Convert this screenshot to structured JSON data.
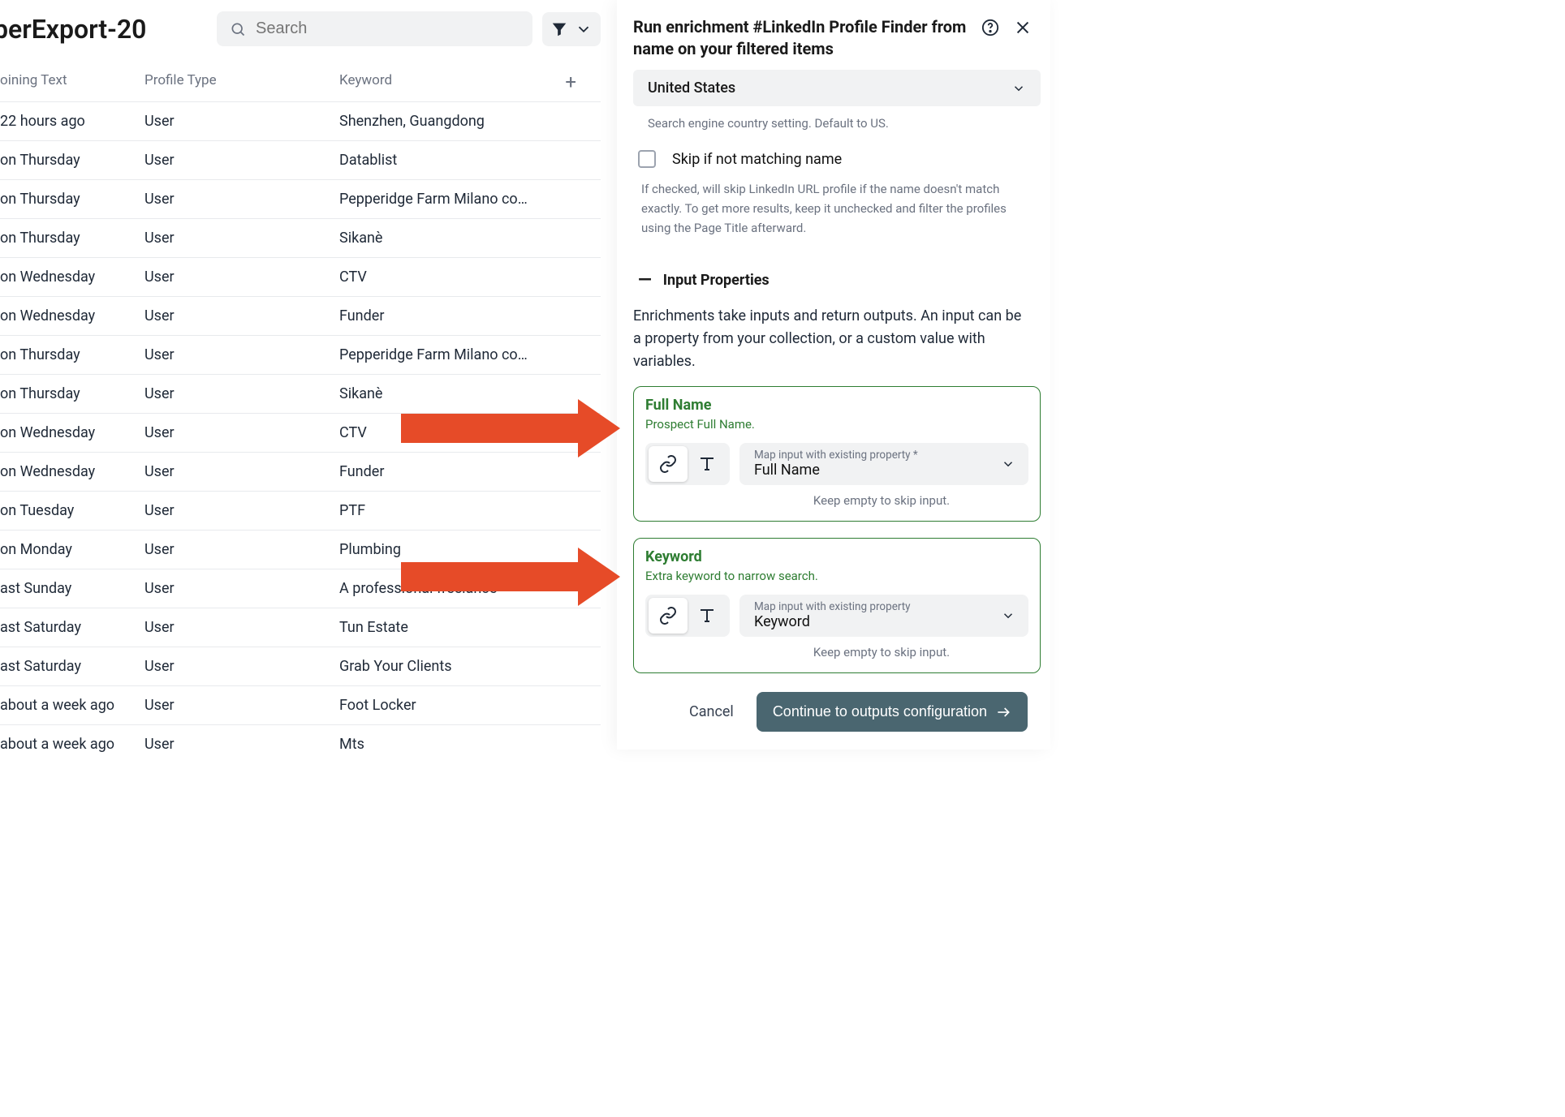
{
  "page": {
    "title": "berExport-20"
  },
  "search": {
    "placeholder": "Search"
  },
  "table": {
    "headers": {
      "joining": "oining Text",
      "profile": "Profile Type",
      "keyword": "Keyword"
    },
    "rows": [
      {
        "joining": "22 hours ago",
        "profile": "User",
        "keyword": "Shenzhen, Guangdong"
      },
      {
        "joining": "on Thursday",
        "profile": "User",
        "keyword": "Datablist"
      },
      {
        "joining": "on Thursday",
        "profile": "User",
        "keyword": "Pepperidge Farm Milano co…"
      },
      {
        "joining": "on Thursday",
        "profile": "User",
        "keyword": "Sikanè"
      },
      {
        "joining": "on Wednesday",
        "profile": "User",
        "keyword": "CTV"
      },
      {
        "joining": "on Wednesday",
        "profile": "User",
        "keyword": "Funder"
      },
      {
        "joining": "on Thursday",
        "profile": "User",
        "keyword": "Pepperidge Farm Milano co…"
      },
      {
        "joining": "on Thursday",
        "profile": "User",
        "keyword": "Sikanè"
      },
      {
        "joining": "on Wednesday",
        "profile": "User",
        "keyword": "CTV"
      },
      {
        "joining": "on Wednesday",
        "profile": "User",
        "keyword": "Funder"
      },
      {
        "joining": "on Tuesday",
        "profile": "User",
        "keyword": "PTF"
      },
      {
        "joining": "on Monday",
        "profile": "User",
        "keyword": "Plumbing"
      },
      {
        "joining": "ast Sunday",
        "profile": "User",
        "keyword": "A professional freelance"
      },
      {
        "joining": "ast Saturday",
        "profile": "User",
        "keyword": "Tun Estate"
      },
      {
        "joining": "ast Saturday",
        "profile": "User",
        "keyword": "Grab Your Clients"
      },
      {
        "joining": "about a week ago",
        "profile": "User",
        "keyword": "Foot Locker"
      },
      {
        "joining": "about a week ago",
        "profile": "User",
        "keyword": "Mts"
      }
    ]
  },
  "panel": {
    "title": "Run enrichment #LinkedIn Profile Finder from name on your filtered items",
    "country": {
      "value": "United States",
      "help": "Search engine country setting. Default to US."
    },
    "skip": {
      "label": "Skip if not matching name",
      "help": "If checked, will skip LinkedIn URL profile if the name doesn't match exactly. To get more results, keep it unchecked and filter the profiles using the Page Title afterward."
    },
    "inputs_section": {
      "title": "Input Properties",
      "desc": "Enrichments take inputs and return outputs. An input can be a property from your collection, or a custom value with variables."
    },
    "full_name": {
      "title": "Full Name",
      "sub": "Prospect Full Name.",
      "map_label": "Map input with existing property *",
      "map_value": "Full Name",
      "skip_note": "Keep empty to skip input."
    },
    "keyword": {
      "title": "Keyword",
      "sub": "Extra keyword to narrow search.",
      "map_label": "Map input with existing property",
      "map_value": "Keyword",
      "skip_note": "Keep empty to skip input."
    },
    "footer": {
      "cancel": "Cancel",
      "continue": "Continue to outputs configuration"
    }
  }
}
